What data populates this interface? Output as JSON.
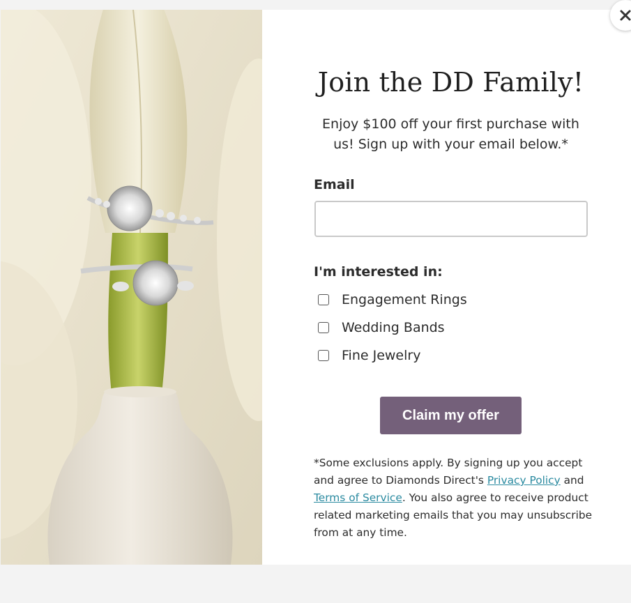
{
  "modal": {
    "title": "Join the DD Family!",
    "subtitle": "Enjoy $100 off your first purchase with us! Sign up with your email below.*",
    "email_label": "Email",
    "email_value": "",
    "interests_label": "I'm interested in:",
    "options": [
      {
        "label": "Engagement Rings",
        "checked": false
      },
      {
        "label": "Wedding Bands",
        "checked": false
      },
      {
        "label": "Fine Jewelry",
        "checked": false
      }
    ],
    "cta_label": "Claim my offer",
    "disclaimer": {
      "part1": "*Some exclusions apply. By signing up you accept and agree to Diamonds Direct's ",
      "privacy_link": "Privacy Policy",
      "part2": " and ",
      "terms_link": "Terms of Service",
      "part3": ". You also agree to receive product related marketing emails that you may unsubscribe from at any time."
    },
    "close_icon": "close-icon"
  },
  "colors": {
    "cta_background": "#74607a",
    "link": "#2a8aa0",
    "hero_background": "#e9e3cf"
  }
}
